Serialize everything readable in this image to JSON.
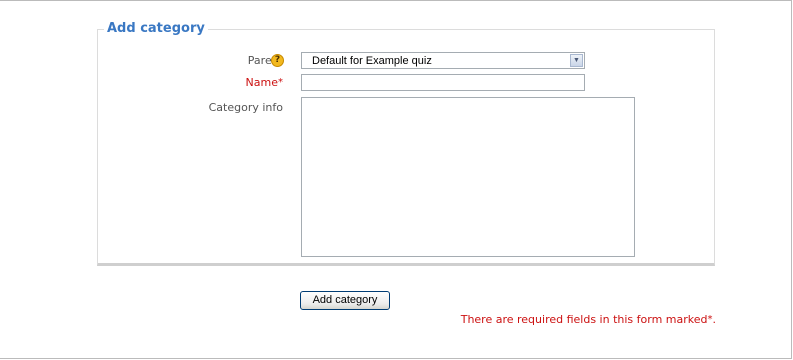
{
  "form": {
    "legend": "Add category",
    "parent": {
      "label": "Parent",
      "help_icon_glyph": "?",
      "selected": "Default for Example quiz",
      "arrow_glyph": "▼"
    },
    "name": {
      "label": "Name",
      "required_mark": "*",
      "value": ""
    },
    "info": {
      "label": "Category info",
      "value": ""
    },
    "submit_label": "Add category",
    "required_note": "There are required fields in this form marked",
    "required_note_mark": "*",
    "required_note_end": "."
  },
  "colors": {
    "legend": "#3a78c3",
    "required": "#cc1111",
    "help_icon": "#f2b81e"
  }
}
